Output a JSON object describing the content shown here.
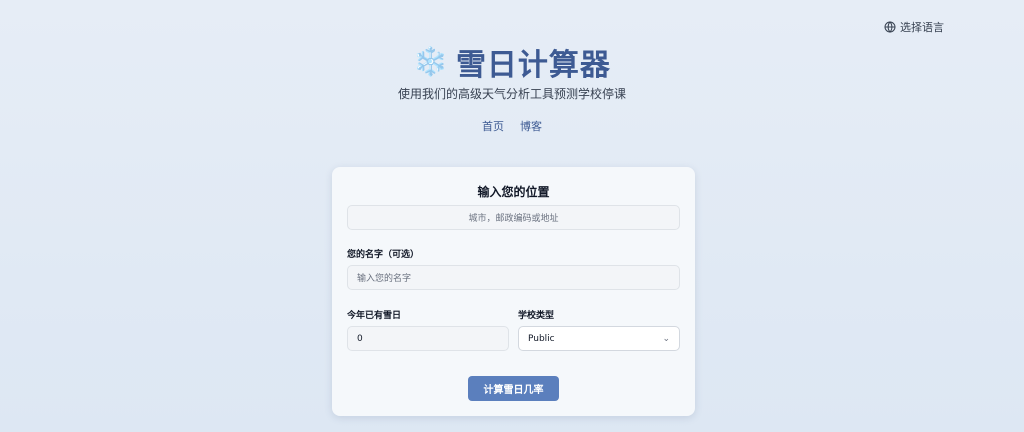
{
  "language": {
    "label": "选择语言",
    "icon": "globe-icon"
  },
  "header": {
    "icon": "snowflake-icon",
    "icon_glyph": "❄️",
    "title": "雪日计算器",
    "subtitle": "使用我们的高级天气分析工具预测学校停课"
  },
  "nav": {
    "home": "首页",
    "blog": "博客"
  },
  "form": {
    "title": "输入您的位置",
    "location_placeholder": "城市，邮政编码或地址",
    "name_label": "您的名字（可选）",
    "name_placeholder": "输入您的名字",
    "snow_days_label": "今年已有雪日",
    "snow_days_value": "0",
    "school_type_label": "学校类型",
    "school_type_value": "Public",
    "submit_label": "计算雪日几率"
  },
  "colors": {
    "accent": "#5b7fbd",
    "title": "#3d5a93"
  }
}
